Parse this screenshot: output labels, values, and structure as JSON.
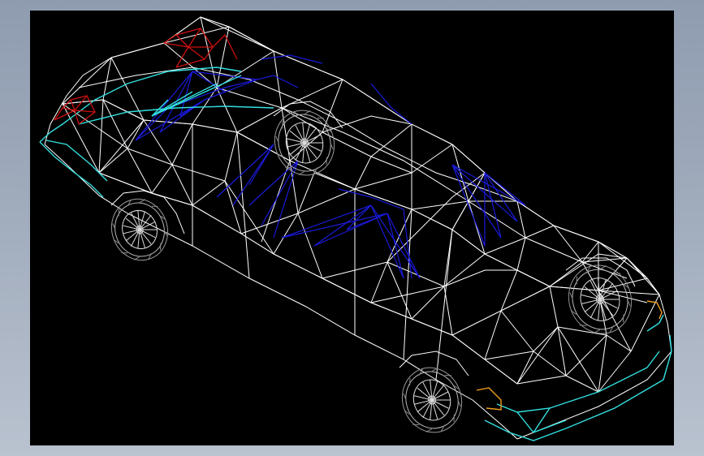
{
  "app": {
    "frame_background": "#a0abbc",
    "viewport_background": "#000000"
  },
  "model": {
    "type": "car",
    "render_mode": "wireframe",
    "line_colors": {
      "body": "#ffffff",
      "glass": "#1a1adb",
      "bumpers": "#33e0e0",
      "tail_lights": "#d01010",
      "indicators": "#f0a020",
      "wheels": "#dcdcdc"
    }
  }
}
